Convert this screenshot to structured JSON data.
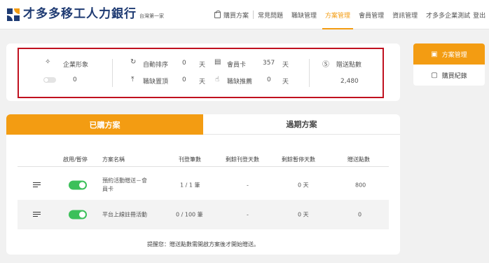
{
  "brand": {
    "name": "才多多移工人力銀行",
    "tagline": "台灣第一家"
  },
  "nav": [
    {
      "label": "購買方案",
      "active": false
    },
    {
      "label": "常見問題",
      "active": false
    },
    {
      "label": "職缺管理",
      "active": false
    },
    {
      "label": "方案管理",
      "active": true
    },
    {
      "label": "會員管理",
      "active": false
    },
    {
      "label": "資訊管理",
      "active": false
    },
    {
      "label": "才多多企業測試",
      "active": false
    },
    {
      "label": "登出",
      "active": false
    }
  ],
  "summary": {
    "corporate_image": {
      "label": "企業形象",
      "value": "0"
    },
    "auto_sort": {
      "label": "自動排序",
      "value": "0",
      "unit": "天"
    },
    "job_top": {
      "label": "職缺置頂",
      "value": "0",
      "unit": "天"
    },
    "member_card": {
      "label": "會員卡",
      "value": "357",
      "unit": "天"
    },
    "job_recommend": {
      "label": "職缺推薦",
      "value": "0",
      "unit": "天"
    },
    "gift_points": {
      "label": "贈送點數",
      "value": "2,480"
    }
  },
  "side_menu": [
    {
      "label": "方案管理",
      "active": true
    },
    {
      "label": "購買紀錄",
      "active": false
    }
  ],
  "tabs": [
    {
      "label": "已購方案",
      "active": true
    },
    {
      "label": "過期方案",
      "active": false
    }
  ],
  "table": {
    "columns": [
      "啟用/暫停",
      "方案名稱",
      "刊登筆數",
      "剩餘刊登天數",
      "剩餘暫停天數",
      "贈送點數"
    ],
    "rows": [
      {
        "name_line1": "預約活動贈送－會",
        "name_line2": "員卡",
        "count": "1 / 1 筆",
        "remain_post": "-",
        "remain_pause": "0 天",
        "points": "800",
        "enabled": true
      },
      {
        "name_line1": "平台上線註冊活動",
        "name_line2": "",
        "count": "0 / 100 筆",
        "remain_post": "-",
        "remain_pause": "0 天",
        "points": "0",
        "enabled": true
      }
    ]
  },
  "notice": "提醒您：贈送點數需開啟方案後才開始贈送。",
  "colors": {
    "accent": "#f39c12",
    "toggle_on": "#3cc05a",
    "highlight": "#c0111f",
    "brand_blue": "#1f3b73"
  }
}
